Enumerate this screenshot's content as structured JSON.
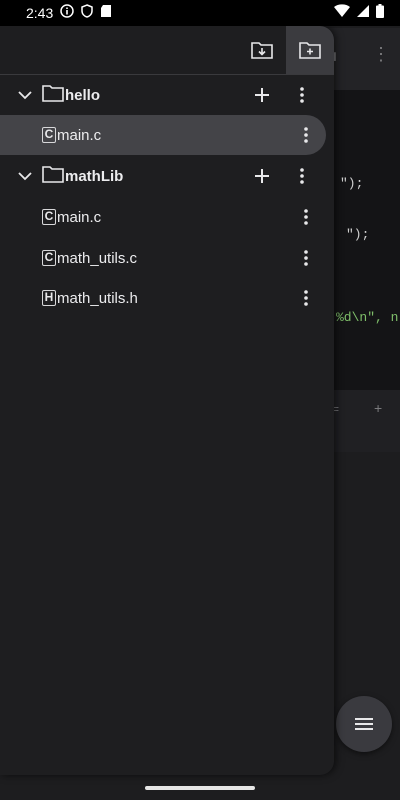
{
  "status_bar": {
    "time": "2:43",
    "icons": [
      "info-icon",
      "shield-icon",
      "sd-card-icon",
      "wifi-icon",
      "signal-icon",
      "battery-icon"
    ]
  },
  "drawer": {
    "toolbar": {
      "buttons": [
        "folder-download-icon",
        "new-folder-icon"
      ]
    },
    "tree": [
      {
        "type": "folder",
        "label": "hello",
        "expanded": true
      },
      {
        "type": "file",
        "label": "main.c",
        "badge": "C",
        "selected": true
      },
      {
        "type": "folder",
        "label": "mathLib",
        "expanded": true
      },
      {
        "type": "file",
        "label": "main.c",
        "badge": "C"
      },
      {
        "type": "file",
        "label": "math_utils.c",
        "badge": "C"
      },
      {
        "type": "file",
        "label": "math_utils.h",
        "badge": "H"
      }
    ]
  },
  "editor": {
    "code_fragments": [
      "\");",
      "\");",
      "%d\\n\", n"
    ],
    "menu_button": "menu-icon"
  },
  "colors": {
    "drawer_bg": "#1e1e20",
    "selected_row": "#444448",
    "editor_bg": "#141416",
    "code_green": "#7fbf6a"
  }
}
